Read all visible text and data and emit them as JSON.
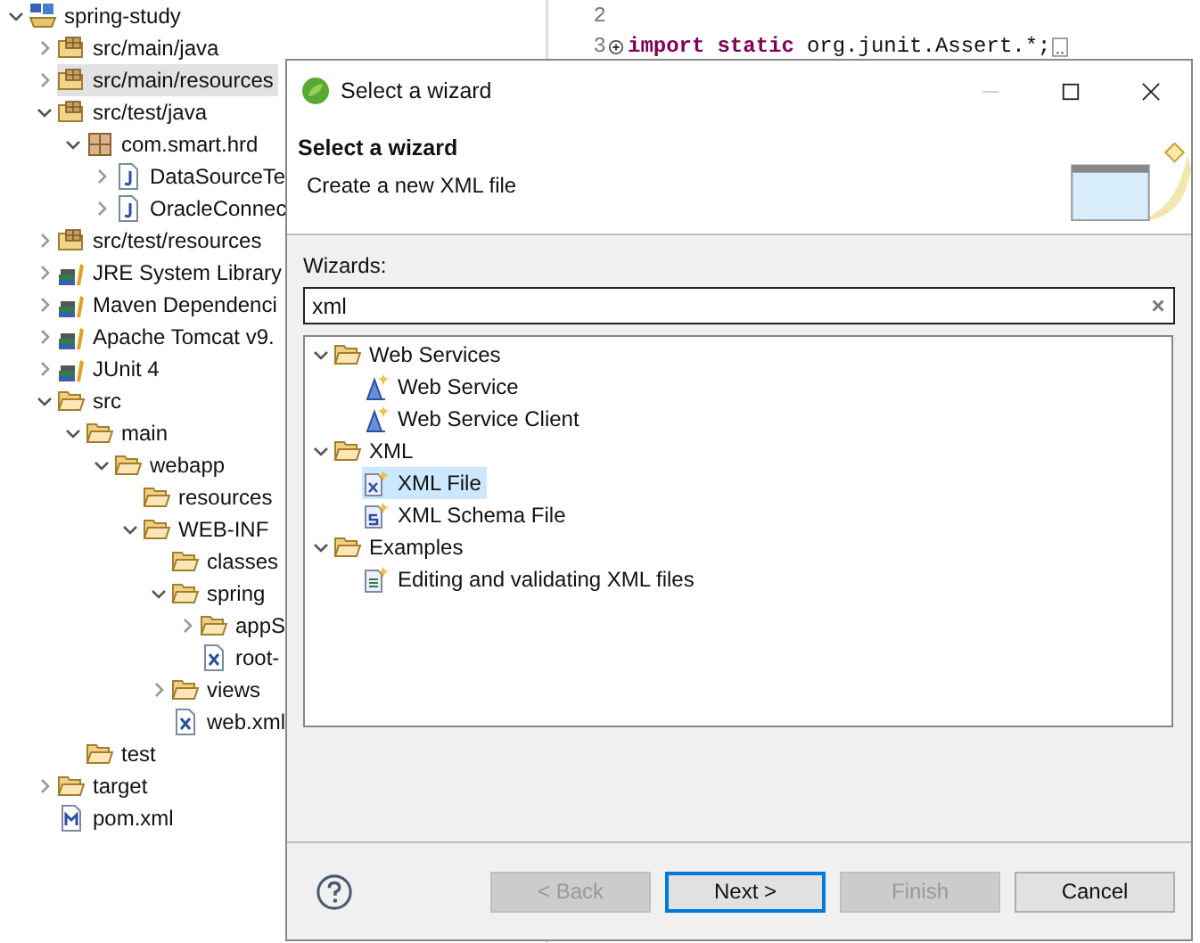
{
  "explorer": {
    "items": [
      {
        "label": "spring-study",
        "kind": "project",
        "expanded": true,
        "selected": false,
        "children": [
          {
            "label": "src/main/java",
            "kind": "source-folder",
            "expanded": false,
            "selected": false
          },
          {
            "label": "src/main/resources",
            "kind": "source-folder",
            "expanded": false,
            "selected": true
          },
          {
            "label": "src/test/java",
            "kind": "source-folder",
            "expanded": true,
            "selected": false,
            "children": [
              {
                "label": "com.smart.hrd",
                "kind": "package",
                "expanded": true,
                "selected": false,
                "children": [
                  {
                    "label": "DataSourceTe",
                    "kind": "java-file",
                    "expanded": false,
                    "selected": false
                  },
                  {
                    "label": "OracleConnec",
                    "kind": "java-file",
                    "expanded": false,
                    "selected": false
                  }
                ]
              }
            ]
          },
          {
            "label": "src/test/resources",
            "kind": "source-folder",
            "expanded": false,
            "selected": false
          },
          {
            "label": "JRE System Library",
            "kind": "library",
            "expanded": false,
            "selected": false
          },
          {
            "label": "Maven Dependenci",
            "kind": "library",
            "expanded": false,
            "selected": false
          },
          {
            "label": "Apache Tomcat v9.",
            "kind": "library",
            "expanded": false,
            "selected": false
          },
          {
            "label": "JUnit 4",
            "kind": "library",
            "expanded": false,
            "selected": false
          },
          {
            "label": "src",
            "kind": "folder",
            "expanded": true,
            "selected": false,
            "children": [
              {
                "label": "main",
                "kind": "folder",
                "expanded": true,
                "selected": false,
                "children": [
                  {
                    "label": "webapp",
                    "kind": "folder",
                    "expanded": true,
                    "selected": false,
                    "children": [
                      {
                        "label": "resources",
                        "kind": "folder",
                        "selected": false
                      },
                      {
                        "label": "WEB-INF",
                        "kind": "folder",
                        "expanded": true,
                        "selected": false,
                        "children": [
                          {
                            "label": "classes",
                            "kind": "folder",
                            "selected": false
                          },
                          {
                            "label": "spring",
                            "kind": "folder",
                            "expanded": true,
                            "selected": false,
                            "children": [
                              {
                                "label": "appS",
                                "kind": "folder",
                                "expanded": false,
                                "selected": false
                              },
                              {
                                "label": "root-",
                                "kind": "xml-file",
                                "selected": false
                              }
                            ]
                          },
                          {
                            "label": "views",
                            "kind": "folder",
                            "expanded": false,
                            "selected": false
                          },
                          {
                            "label": "web.xml",
                            "kind": "xml-file",
                            "selected": false
                          }
                        ]
                      }
                    ]
                  }
                ]
              },
              {
                "label": "test",
                "kind": "folder",
                "selected": false
              }
            ]
          },
          {
            "label": "target",
            "kind": "folder",
            "expanded": false,
            "selected": false
          },
          {
            "label": "pom.xml",
            "kind": "maven-file",
            "selected": false
          }
        ]
      }
    ]
  },
  "editor": {
    "lines": [
      {
        "number": "2",
        "folded": false
      },
      {
        "number": "3",
        "folded": true,
        "segments": [
          {
            "text": "import",
            "kind": "keyword"
          },
          {
            "text": "static",
            "kind": "keyword"
          },
          {
            "text": "org.junit.Assert.*;",
            "kind": "plain"
          }
        ]
      }
    ]
  },
  "dialog": {
    "title": "Select a wizard",
    "heading": "Select a wizard",
    "description": "Create a new XML file",
    "filter_label": "Wizards:",
    "filter_value": "xml",
    "wizards": [
      {
        "label": "Web Services",
        "kind": "folder",
        "expanded": true,
        "selected": false,
        "children": [
          {
            "label": "Web Service",
            "kind": "service",
            "selected": false
          },
          {
            "label": "Web Service Client",
            "kind": "service",
            "selected": false
          }
        ]
      },
      {
        "label": "XML",
        "kind": "folder",
        "expanded": true,
        "selected": false,
        "children": [
          {
            "label": "XML File",
            "kind": "xml-file-new",
            "selected": true
          },
          {
            "label": "XML Schema File",
            "kind": "schema-file-new",
            "selected": false
          }
        ]
      },
      {
        "label": "Examples",
        "kind": "folder",
        "expanded": true,
        "selected": false,
        "children": [
          {
            "label": "Editing and validating XML files",
            "kind": "example",
            "selected": false
          }
        ]
      }
    ],
    "buttons": [
      {
        "label": "< Back",
        "disabled": true,
        "default": false
      },
      {
        "label": "Next >",
        "disabled": false,
        "default": true
      },
      {
        "label": "Finish",
        "disabled": true,
        "default": false
      },
      {
        "label": "Cancel",
        "disabled": false,
        "default": false
      }
    ]
  }
}
